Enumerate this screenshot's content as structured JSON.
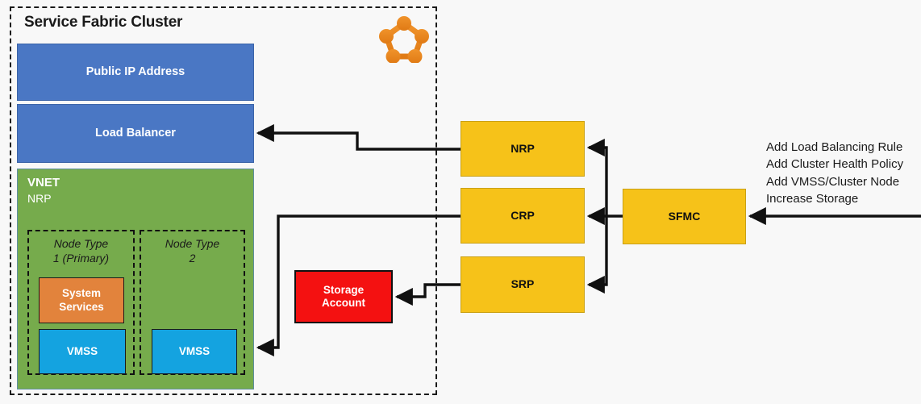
{
  "diagram": {
    "title": "Service Fabric Cluster",
    "logo_icon": "service-fabric-logo-icon",
    "colors": {
      "blue": "#4a77c4",
      "green": "#76ab4c",
      "orange": "#e2833c",
      "cyan": "#14a3e0",
      "yellow": "#f6c219",
      "red": "#f41111",
      "logo_orange": "#ec8b23",
      "line": "#111111"
    }
  },
  "cluster": {
    "public_ip": "Public IP Address",
    "load_balancer": "Load Balancer",
    "vnet": {
      "label": "VNET",
      "sublabel": "NRP",
      "node_types": [
        {
          "label": "Node Type\n1 (Primary)",
          "label_line1": "Node Type",
          "label_line2": "1 (Primary)",
          "children": [
            {
              "label": "System\nServices",
              "label_line1": "System",
              "label_line2": "Services",
              "kind": "system-services"
            },
            {
              "label": "VMSS",
              "kind": "vmss"
            }
          ]
        },
        {
          "label": "Node Type\n2",
          "label_line1": "Node Type",
          "label_line2": "2",
          "children": [
            {
              "label": "VMSS",
              "kind": "vmss"
            }
          ]
        }
      ]
    },
    "storage_account": {
      "label": "Storage\nAccount",
      "label_line1": "Storage",
      "label_line2": "Account"
    }
  },
  "providers": {
    "nrp": "NRP",
    "crp": "CRP",
    "srp": "SRP",
    "sfmc": "SFMC"
  },
  "actions": [
    "Add Load Balancing Rule",
    "Add Cluster Health Policy",
    "Add VMSS/Cluster Node",
    "Increase Storage"
  ]
}
